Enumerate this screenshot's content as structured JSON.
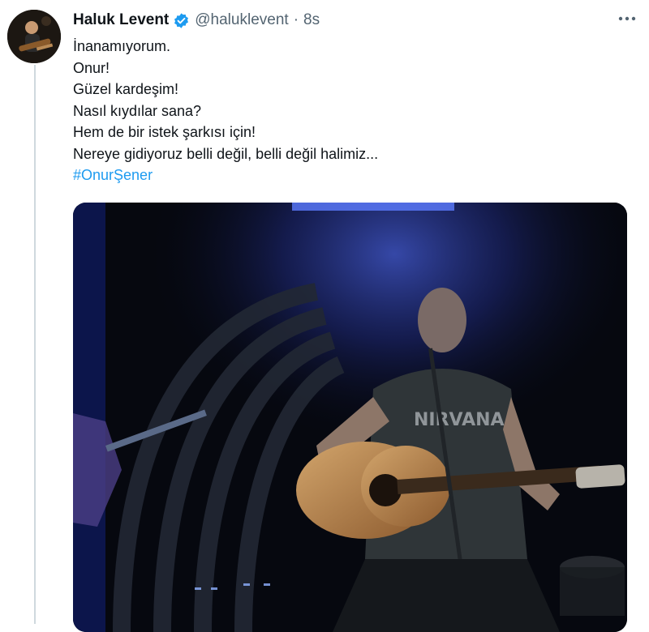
{
  "tweet": {
    "author": {
      "display_name": "Haluk Levent",
      "handle": "@haluklevent",
      "verified": true,
      "avatar_icon": "avatar-guitarist"
    },
    "separator": "·",
    "time": "8s",
    "more_icon": "more-horizontal-icon",
    "lines": [
      "İnanamıyorum.",
      "Onur!",
      "Güzel kardeşim!",
      "Nasıl kıydılar sana?",
      "Hem de bir istek şarkısı için!",
      "Nereye gidiyoruz belli değil, belli değil halimiz..."
    ],
    "hashtag": "#OnurŞener",
    "media": {
      "type": "video",
      "description_icon": "stage-performance-video",
      "shirt_text": "NIRVANA"
    }
  },
  "colors": {
    "text": "#0f1419",
    "secondary": "#536471",
    "link": "#1d9bf0",
    "verified": "#1d9bf0"
  }
}
